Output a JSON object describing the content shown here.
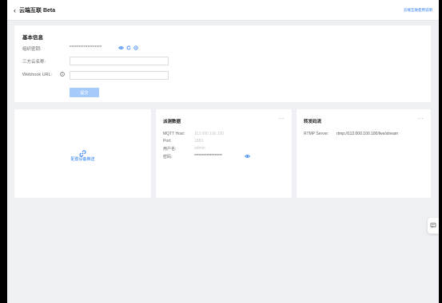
{
  "header": {
    "back_glyph": "‹",
    "title": "云端互联 Beta",
    "help_link": "云端互联使用说明"
  },
  "basic_info": {
    "title": "基本信息",
    "org_secret_label": "组织密钥:",
    "org_secret_value": "******************",
    "third_party_label": "三方云名称:",
    "third_party_value": "",
    "webhook_label": "Webhook URL:",
    "webhook_value": "",
    "submit_label": "提交"
  },
  "config_card": {
    "link_label": "配置设备推送"
  },
  "mqtt_card": {
    "title": "派测数据",
    "more": "···",
    "rows": [
      {
        "label": "MQTT Host:",
        "value": "112.000.100.100"
      },
      {
        "label": "Port:",
        "value": "1883"
      },
      {
        "label": "用户名:",
        "value": "admin"
      },
      {
        "label": "密码:",
        "value": "******************"
      }
    ]
  },
  "rtmp_card": {
    "title": "转发码流",
    "more": "···",
    "rtmp_label": "RTMP Server:",
    "rtmp_value": "rtmp://112.000.100.100/live/stream"
  },
  "colors": {
    "accent": "#2b7ef2",
    "background": "#eef0f3",
    "disabled_button": "#a6cbfb"
  },
  "icons": [
    "eye-icon",
    "refresh-icon",
    "copy-icon",
    "link-icon",
    "feedback-icon"
  ]
}
